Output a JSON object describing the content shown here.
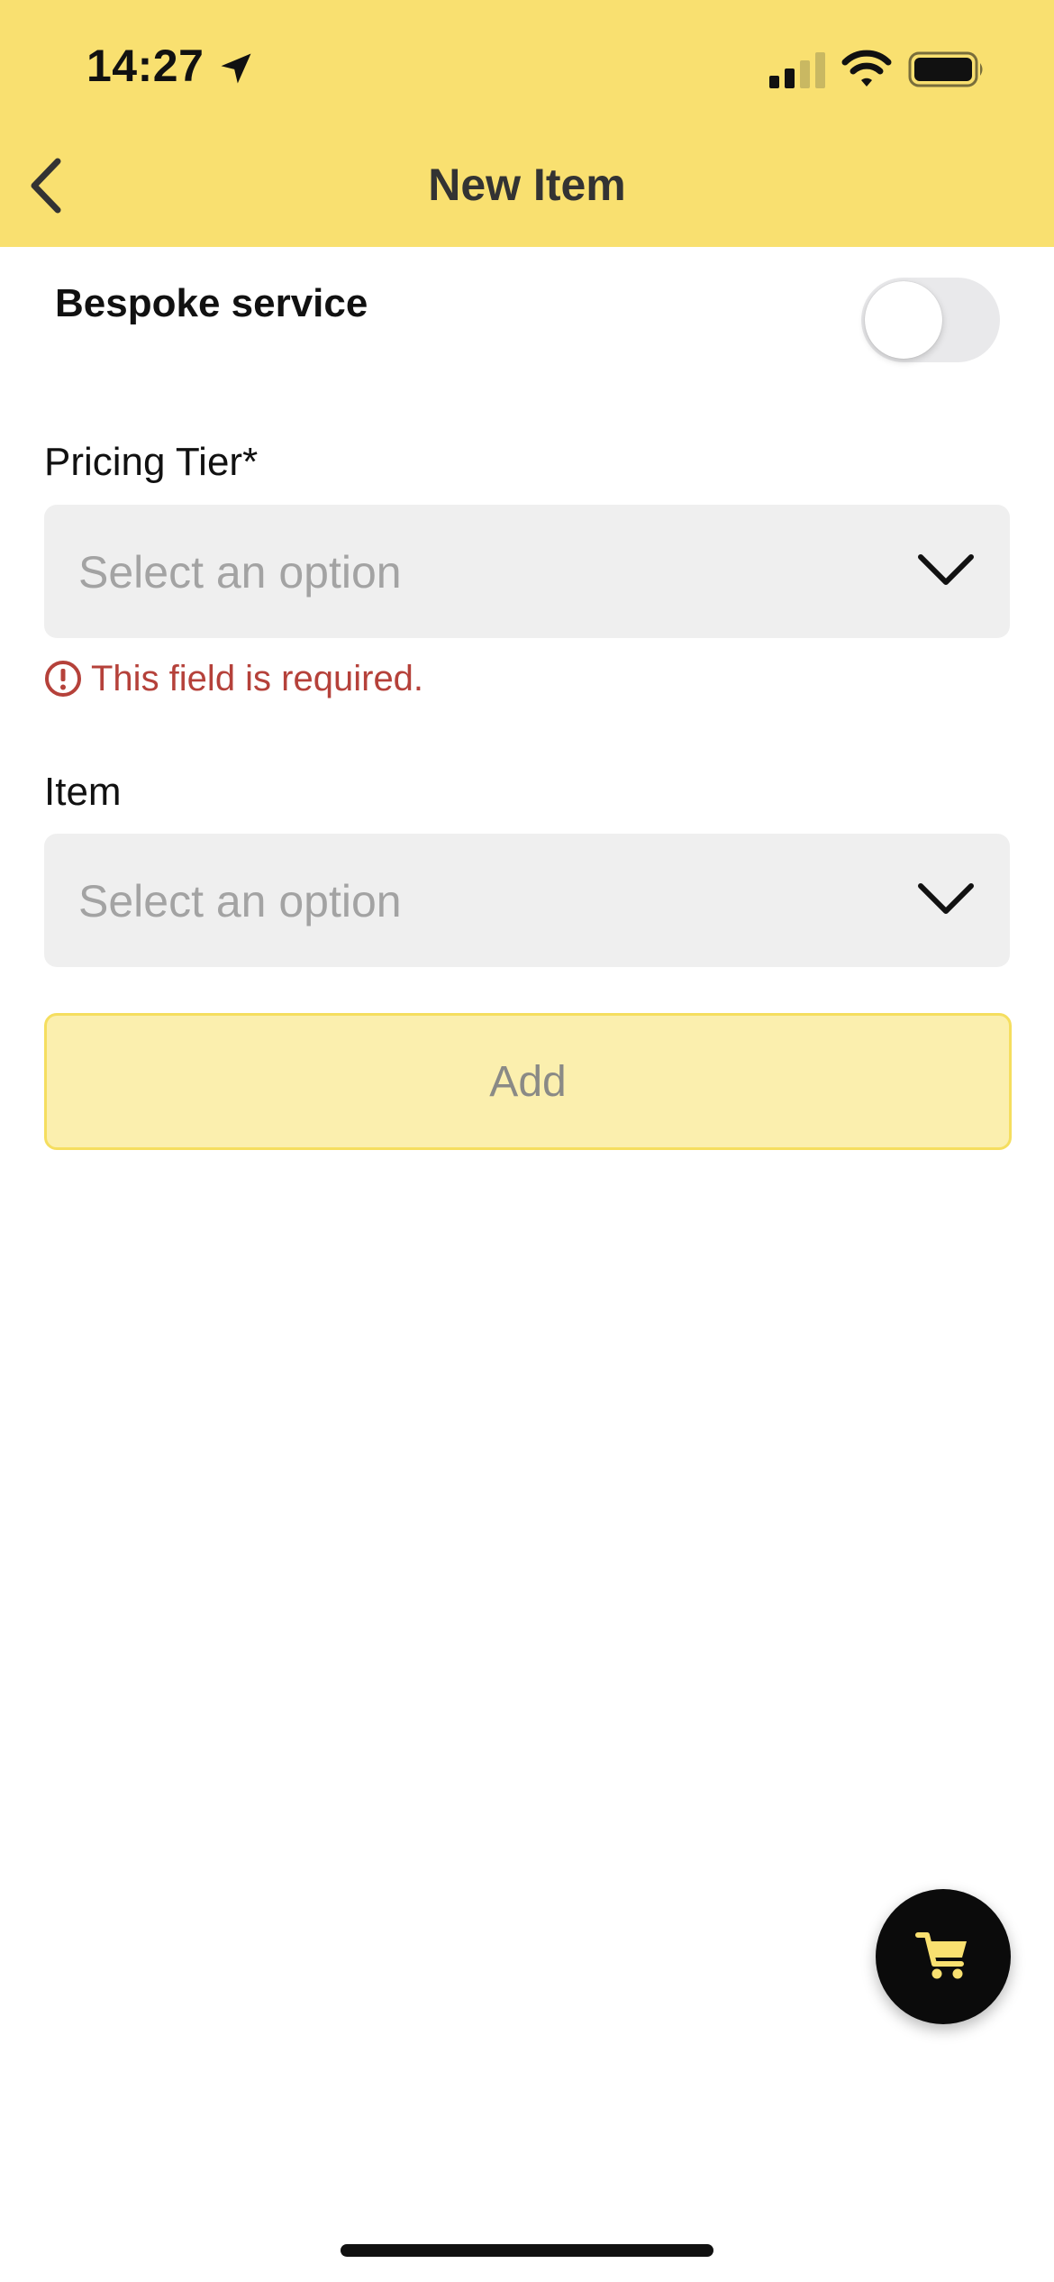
{
  "status_bar": {
    "time": "14:27"
  },
  "header": {
    "title": "New Item",
    "back_icon": "chevron-left-icon"
  },
  "bespoke": {
    "label": "Bespoke service",
    "enabled": false
  },
  "pricing_tier": {
    "label": "Pricing Tier*",
    "placeholder": "Select an option",
    "error": "This field is required."
  },
  "item": {
    "label": "Item",
    "placeholder": "Select an option"
  },
  "actions": {
    "add_label": "Add"
  },
  "fab": {
    "icon": "cart-icon"
  },
  "colors": {
    "header_bg": "#f9e070",
    "error": "#b5413a",
    "button_bg_disabled": "#fbefae",
    "button_border": "#f5de5f",
    "field_bg": "#efefef",
    "cart_icon": "#f9e070"
  }
}
